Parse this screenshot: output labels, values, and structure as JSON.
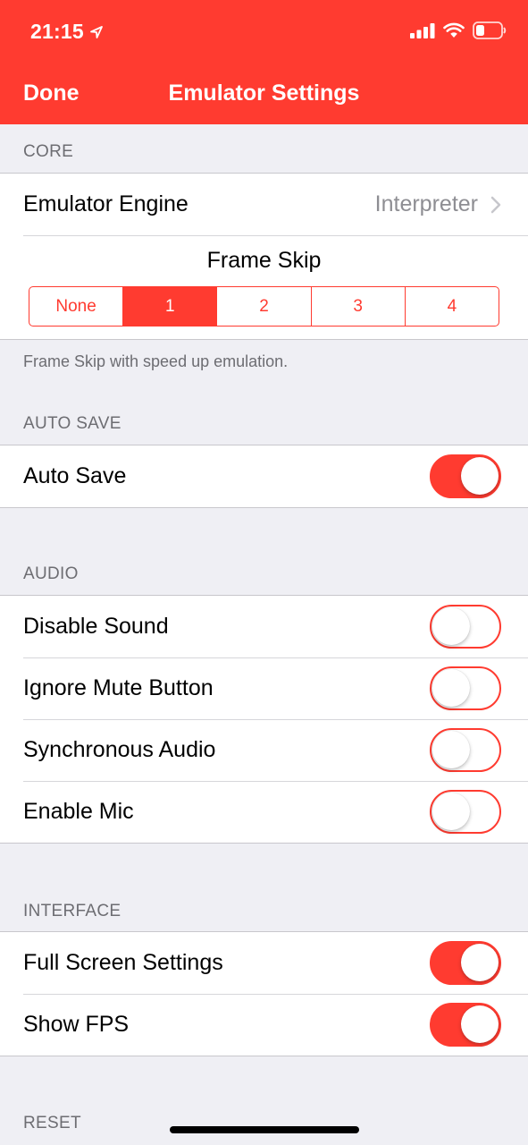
{
  "status_bar": {
    "time": "21:15"
  },
  "nav": {
    "done_label": "Done",
    "title": "Emulator Settings"
  },
  "sections": {
    "core": {
      "header": "CORE",
      "emulator_engine_label": "Emulator Engine",
      "emulator_engine_value": "Interpreter",
      "frame_skip_title": "Frame Skip",
      "frame_skip_options": [
        "None",
        "1",
        "2",
        "3",
        "4"
      ],
      "frame_skip_selected": "1",
      "footer": "Frame Skip with speed up emulation."
    },
    "auto_save": {
      "header": "AUTO SAVE",
      "auto_save_label": "Auto Save",
      "auto_save_on": true
    },
    "audio": {
      "header": "AUDIO",
      "disable_sound_label": "Disable Sound",
      "disable_sound_on": false,
      "ignore_mute_label": "Ignore Mute Button",
      "ignore_mute_on": false,
      "sync_audio_label": "Synchronous Audio",
      "sync_audio_on": false,
      "enable_mic_label": "Enable Mic",
      "enable_mic_on": false
    },
    "interface": {
      "header": "INTERFACE",
      "full_screen_label": "Full Screen Settings",
      "full_screen_on": true,
      "show_fps_label": "Show FPS",
      "show_fps_on": true
    },
    "reset": {
      "header": "RESET"
    }
  },
  "colors": {
    "accent": "#ff3b30",
    "background": "#efeff4",
    "secondary_text": "#6d6d72"
  },
  "icons": [
    "location-arrow-icon",
    "signal-icon",
    "wifi-icon",
    "battery-icon",
    "chevron-right-icon"
  ]
}
